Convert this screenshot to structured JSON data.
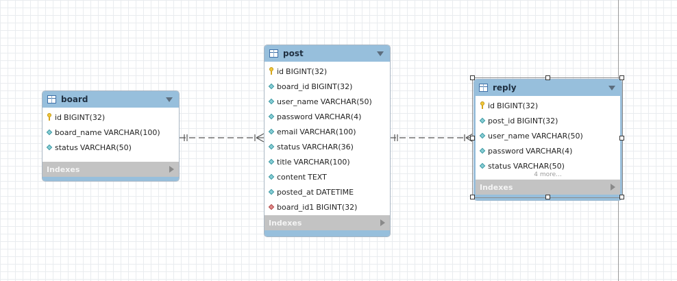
{
  "tables": {
    "board": {
      "name": "board",
      "columns": [
        {
          "name": "id",
          "type": "BIGINT(32)",
          "kind": "key"
        },
        {
          "name": "board_name",
          "type": "VARCHAR(100)",
          "kind": "column"
        },
        {
          "name": "status",
          "type": "VARCHAR(50)",
          "kind": "column"
        }
      ],
      "indexes_label": "Indexes"
    },
    "post": {
      "name": "post",
      "columns": [
        {
          "name": "id",
          "type": "BIGINT(32)",
          "kind": "key"
        },
        {
          "name": "board_id",
          "type": "BIGINT(32)",
          "kind": "column"
        },
        {
          "name": "user_name",
          "type": "VARCHAR(50)",
          "kind": "column"
        },
        {
          "name": "password",
          "type": "VARCHAR(4)",
          "kind": "column"
        },
        {
          "name": "email",
          "type": "VARCHAR(100)",
          "kind": "column"
        },
        {
          "name": "status",
          "type": "VARCHAR(36)",
          "kind": "column"
        },
        {
          "name": "title",
          "type": "VARCHAR(100)",
          "kind": "column"
        },
        {
          "name": "content",
          "type": "TEXT",
          "kind": "column"
        },
        {
          "name": "posted_at",
          "type": "DATETIME",
          "kind": "column"
        },
        {
          "name": "board_id1",
          "type": "BIGINT(32)",
          "kind": "foreign-key"
        }
      ],
      "indexes_label": "Indexes"
    },
    "reply": {
      "name": "reply",
      "columns": [
        {
          "name": "id",
          "type": "BIGINT(32)",
          "kind": "key"
        },
        {
          "name": "post_id",
          "type": "BIGINT(32)",
          "kind": "column"
        },
        {
          "name": "user_name",
          "type": "VARCHAR(50)",
          "kind": "column"
        },
        {
          "name": "password",
          "type": "VARCHAR(4)",
          "kind": "column"
        },
        {
          "name": "status",
          "type": "VARCHAR(50)",
          "kind": "column"
        }
      ],
      "more_label": "4 more...",
      "indexes_label": "Indexes"
    }
  },
  "relationships": [
    {
      "from": "board",
      "to": "post",
      "from_cardinality": "one-and-only-one",
      "to_cardinality": "zero-or-many",
      "style": "dashed"
    },
    {
      "from": "post",
      "to": "reply",
      "from_cardinality": "one-and-only-one",
      "to_cardinality": "zero-or-many",
      "style": "dashed"
    }
  ],
  "selected_table": "reply",
  "colors": {
    "header": "#97bfdc",
    "indexes_bar": "#c3c3c3",
    "grid": "#e9ecef",
    "connector": "#555555"
  }
}
